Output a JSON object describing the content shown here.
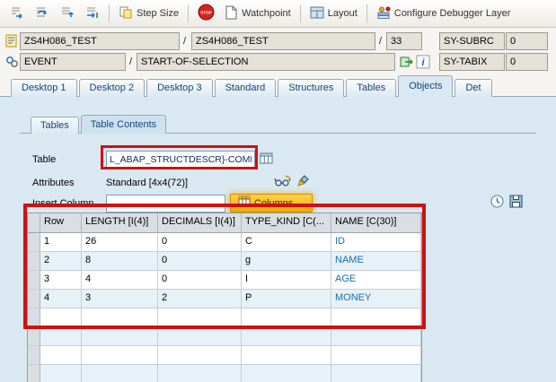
{
  "toolbar": {
    "step_size": "Step Size",
    "stop": "STOP",
    "watchpoint": "Watchpoint",
    "layout": "Layout",
    "configure": "Configure Debugger Layer"
  },
  "context": {
    "separator": "/",
    "program": "ZS4H086_TEST",
    "include": "ZS4H086_TEST",
    "line": "33",
    "sy_subrc_label": "SY-SUBRC",
    "sy_subrc_value": "0",
    "event_label": "EVENT",
    "event_value": "START-OF-SELECTION",
    "sy_tabix_label": "SY-TABIX",
    "sy_tabix_value": "0"
  },
  "main_tabs": [
    {
      "label": "Desktop 1",
      "active": false
    },
    {
      "label": "Desktop 2",
      "active": false
    },
    {
      "label": "Desktop 3",
      "active": false
    },
    {
      "label": "Standard",
      "active": false
    },
    {
      "label": "Structures",
      "active": false
    },
    {
      "label": "Tables",
      "active": false
    },
    {
      "label": "Objects",
      "active": true
    },
    {
      "label": "Det",
      "active": false
    }
  ],
  "sub_tabs": [
    {
      "label": "Tables",
      "active": false
    },
    {
      "label": "Table Contents",
      "active": true
    }
  ],
  "form": {
    "table_label": "Table",
    "table_value": "L_ABAP_STRUCTDESCR}-COMPONENTS",
    "attributes_label": "Attributes",
    "attributes_value": "Standard [4x4(72)]",
    "insert_column_label": "Insert Column",
    "insert_column_value": "",
    "columns_button": "Columns ..."
  },
  "grid": {
    "columns": [
      "Row",
      "LENGTH [I(4)]",
      "DECIMALS [I(4)]",
      "TYPE_KIND [C(...",
      "NAME [C(30)]"
    ],
    "rows": [
      [
        "1",
        "26",
        "0",
        "C",
        "ID"
      ],
      [
        "2",
        "8",
        "0",
        "g",
        "NAME"
      ],
      [
        "3",
        "4",
        "0",
        "I",
        "AGE"
      ],
      [
        "4",
        "3",
        "2",
        "P",
        "MONEY"
      ]
    ],
    "name_column_index": 4
  },
  "icons": {
    "toolbar": [
      "step-into-icon",
      "step-over-icon",
      "step-return-icon",
      "step-continue-icon",
      "step-size-icon",
      "stop-icon",
      "watchpoint-icon",
      "layout-icon",
      "configure-icon"
    ],
    "context": [
      "program-icon",
      "event-icon",
      "goto-source-icon",
      "info-icon"
    ],
    "form": [
      "table-select-icon",
      "display-change-icon",
      "edit-icon",
      "columns-grid-icon",
      "clock-icon",
      "save-layout-icon"
    ]
  },
  "colors": {
    "annotation_red": "#cc1212",
    "highlight_orange": "#ffb400",
    "content_bg": "#d9e8f1",
    "name_text_blue": "#186cae"
  }
}
